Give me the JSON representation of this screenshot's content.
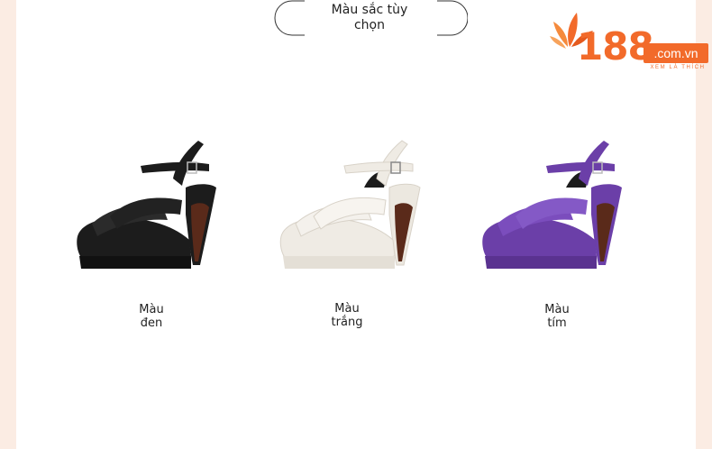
{
  "header": {
    "title_line1": "Màu sắc tùy",
    "title_line2": "chọn"
  },
  "logo": {
    "number": "188",
    "domain": ".com.vn",
    "tagline": "XEM LÀ THÍCH",
    "brand_color": "#f26a2a"
  },
  "variants": [
    {
      "line1": "Màu",
      "line2": "đen",
      "color": "#1c1c1c"
    },
    {
      "line1": "Màu",
      "line2": "trắng",
      "color": "#efebe4"
    },
    {
      "line1": "Màu",
      "line2": "tím",
      "color": "#6b3fa8"
    }
  ]
}
